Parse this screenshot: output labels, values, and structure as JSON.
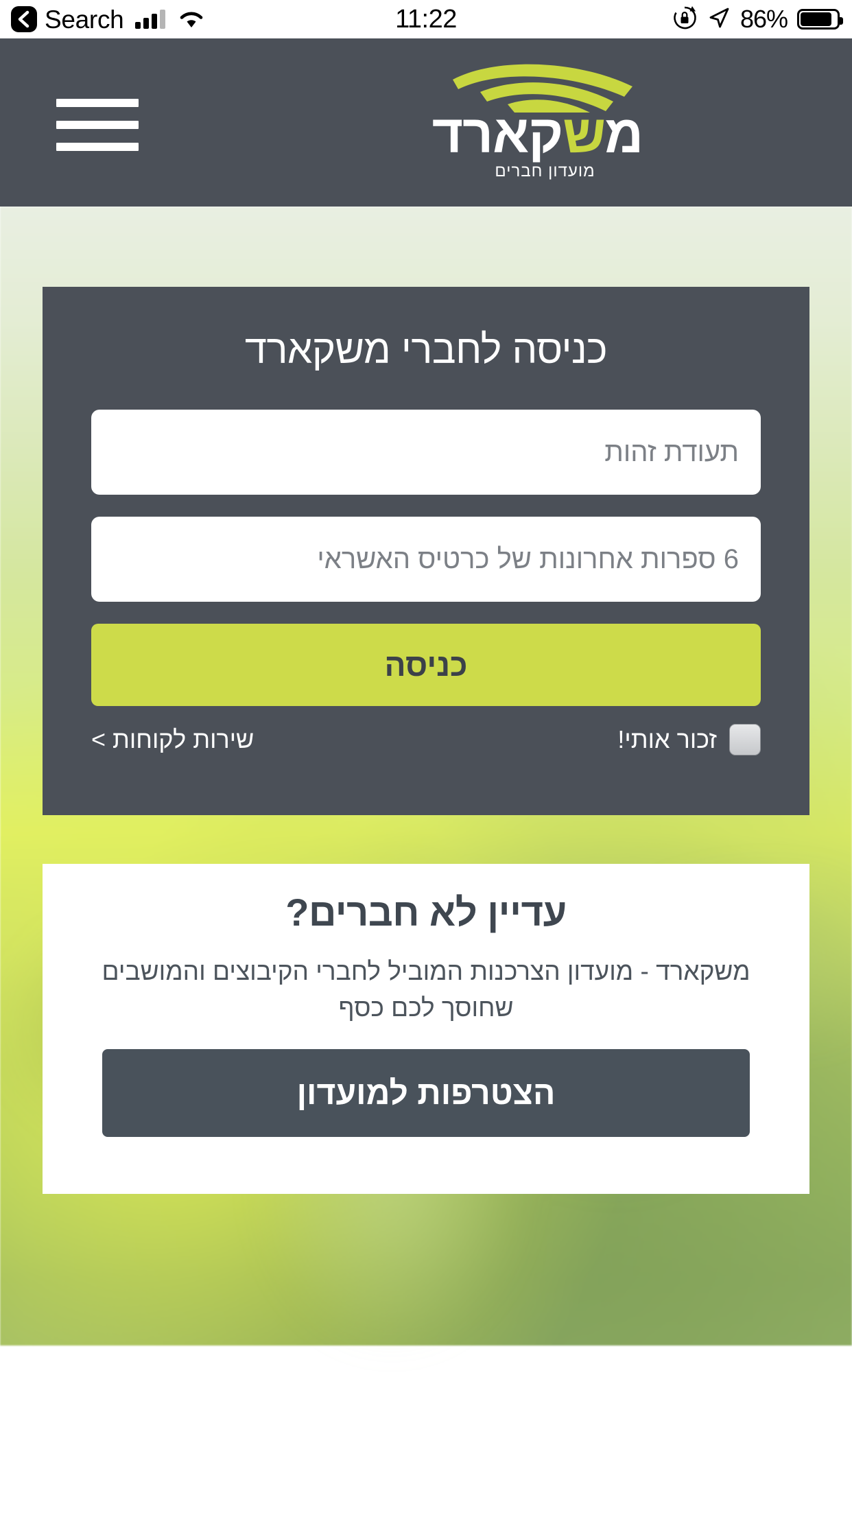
{
  "status_bar": {
    "back_label": "Search",
    "time": "11:22",
    "battery_percent": "86%",
    "icons": {
      "back": "chevron-left-icon",
      "cellular": "cellular-signal-icon",
      "wifi": "wifi-icon",
      "rotation_lock": "rotation-lock-icon",
      "location": "location-arrow-icon",
      "battery": "battery-icon"
    }
  },
  "header": {
    "logo_text": "משקארד",
    "logo_accent_letter": "ש",
    "logo_subtitle": "מועדון חברים",
    "menu_icon": "hamburger-menu-icon",
    "background_color": "#4b5058"
  },
  "login_card": {
    "title": "כניסה לחברי משקארד",
    "background_color": "#4b5058",
    "fields": [
      {
        "name": "id-number",
        "placeholder": "תעודת זהות",
        "value": ""
      },
      {
        "name": "credit-card-last6",
        "placeholder": "6 ספרות אחרונות של כרטיס האשראי",
        "value": ""
      }
    ],
    "submit_label": "כניסה",
    "submit_color": "#cddb4a",
    "remember_label": "זכור אותי!",
    "remember_checked": false,
    "service_link": "שירות לקוחות >"
  },
  "join_card": {
    "title": "עדיין לא חברים?",
    "description": "משקארד - מועדון הצרכנות המוביל לחברי הקיבוצים והמושבים שחוסך לכם כסף",
    "button_label": "הצטרפות למועדון",
    "button_color": "#49525b",
    "background_color": "#ffffff"
  }
}
